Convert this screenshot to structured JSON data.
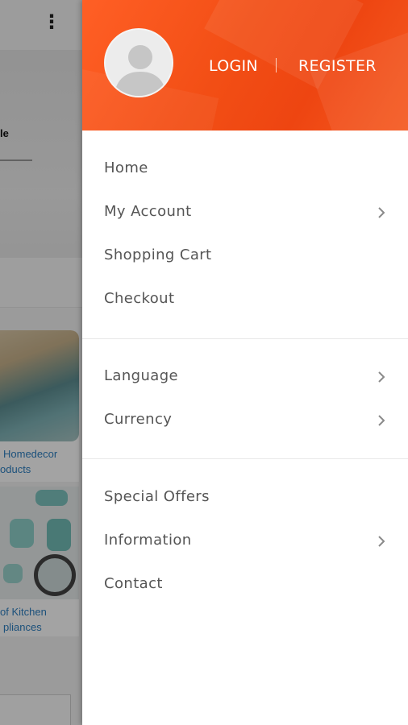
{
  "background": {
    "banner_title": "le",
    "card1_caption_line1": "Homedecor",
    "card1_caption_line2": "oducts",
    "card2_caption_line1": "of Kitchen",
    "card2_caption_line2": "pliances"
  },
  "drawer": {
    "header": {
      "login_label": "LOGIN",
      "separator": "|",
      "register_label": "REGISTER",
      "accent_color": "#f04a14"
    },
    "sections": [
      {
        "items": [
          {
            "label": "Home",
            "has_submenu": false
          },
          {
            "label": "My Account",
            "has_submenu": true
          },
          {
            "label": "Shopping Cart",
            "has_submenu": false
          },
          {
            "label": "Checkout",
            "has_submenu": false
          }
        ]
      },
      {
        "items": [
          {
            "label": "Language",
            "has_submenu": true
          },
          {
            "label": "Currency",
            "has_submenu": true
          }
        ]
      },
      {
        "items": [
          {
            "label": "Special Offers",
            "has_submenu": false
          },
          {
            "label": "Information",
            "has_submenu": true
          },
          {
            "label": "Contact",
            "has_submenu": false
          }
        ]
      }
    ],
    "icons": {
      "avatar": "user-avatar-icon",
      "chevron": "chevron-right-icon"
    }
  }
}
